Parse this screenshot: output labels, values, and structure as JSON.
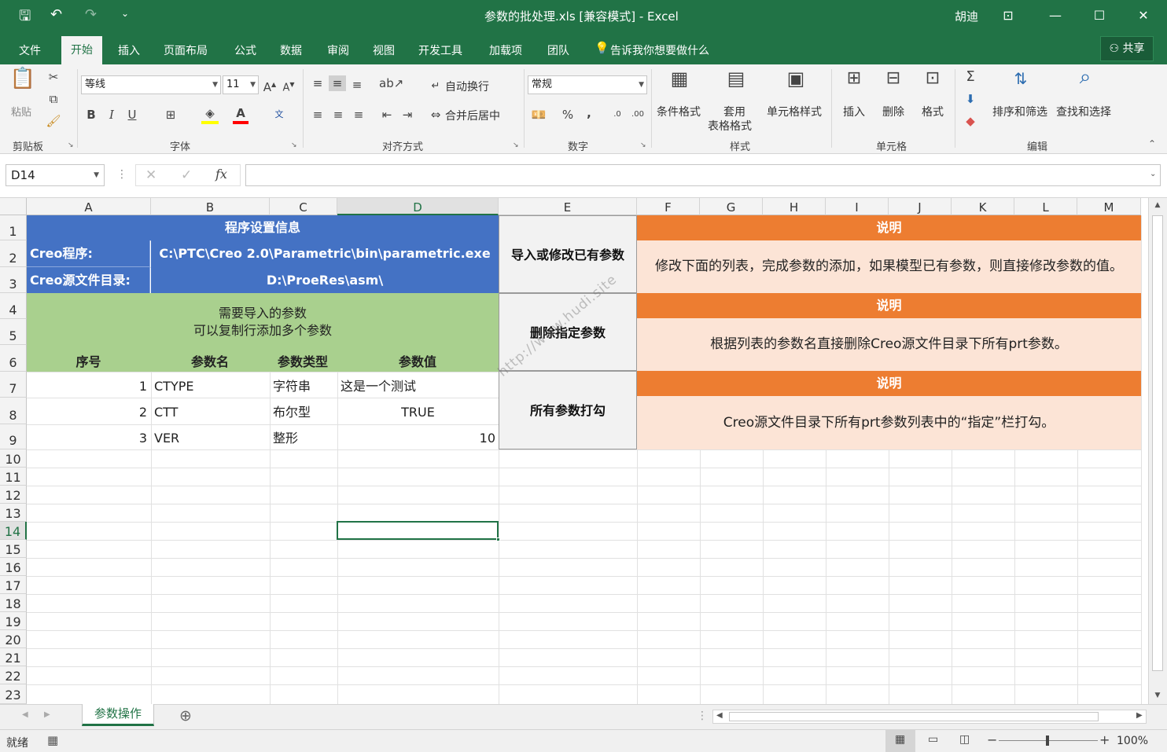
{
  "window": {
    "title": "参数的批处理.xls  [兼容模式]  -  Excel",
    "user": "胡迪",
    "controls": {
      "ribbon_display": "⊡",
      "minimize": "—",
      "maximize": "☐",
      "close": "✕"
    }
  },
  "quick_access": {
    "save": "🖫",
    "undo": "↶",
    "redo": "↷",
    "customize": "⌄"
  },
  "tabs": [
    "文件",
    "开始",
    "插入",
    "页面布局",
    "公式",
    "数据",
    "审阅",
    "视图",
    "开发工具",
    "加载项",
    "团队"
  ],
  "active_tab": "开始",
  "tell_me": "告诉我你想要做什么",
  "share": "共享",
  "ribbon": {
    "clipboard": {
      "paste": "粘贴",
      "label": "剪贴板"
    },
    "font": {
      "name": "等线",
      "size": "11",
      "bold": "B",
      "italic": "I",
      "underline": "U",
      "label": "字体"
    },
    "alignment": {
      "wrap": "自动换行",
      "merge": "合并后居中",
      "label": "对齐方式"
    },
    "number": {
      "format": "常规",
      "percent": "%",
      "comma": ",",
      "label": "数字"
    },
    "styles": {
      "conditional": "条件格式",
      "table_1": "套用",
      "table_2": "表格格式",
      "cell_styles": "单元格样式",
      "label": "样式"
    },
    "cells": {
      "insert": "插入",
      "delete": "删除",
      "format": "格式",
      "label": "单元格"
    },
    "editing": {
      "sort": "排序和筛选",
      "find": "查找和选择",
      "label": "编辑"
    }
  },
  "formula_bar": {
    "name_box": "D14",
    "cancel": "✕",
    "enter": "✓",
    "fx": "fx",
    "value": ""
  },
  "columns": [
    "A",
    "B",
    "C",
    "D",
    "E",
    "F",
    "G",
    "H",
    "I",
    "J",
    "K",
    "L",
    "M"
  ],
  "selected_column": "D",
  "rows": [
    "1",
    "2",
    "3",
    "4",
    "5",
    "6",
    "7",
    "8",
    "9",
    "10",
    "11",
    "12",
    "13",
    "14",
    "15",
    "16",
    "17",
    "18",
    "19",
    "20",
    "21",
    "22",
    "23"
  ],
  "selected_row": "14",
  "sheet": {
    "settings_title": "程序设置信息",
    "creo_label": "Creo程序:",
    "creo_path": "C:\\PTC\\Creo 2.0\\Parametric\\bin\\parametric.exe",
    "src_label": "Creo源文件目录:",
    "src_path": "D:\\ProeRes\\asm\\",
    "params_title_1": "需要导入的参数",
    "params_title_2": "可以复制行添加多个参数",
    "headers": [
      "序号",
      "参数名",
      "参数类型",
      "参数值"
    ],
    "params": [
      {
        "no": "1",
        "name": "CTYPE",
        "type": "字符串",
        "value": "这是一个测试"
      },
      {
        "no": "2",
        "name": "CTT",
        "type": "布尔型",
        "value": "TRUE"
      },
      {
        "no": "3",
        "name": "VER",
        "type": "整形",
        "value": "10"
      }
    ],
    "actions": [
      {
        "button": "导入或修改已有参数",
        "header": "说明",
        "desc": "修改下面的列表，完成参数的添加，如果模型已有参数，则直接修改参数的值。"
      },
      {
        "button": "删除指定参数",
        "header": "说明",
        "desc": "根据列表的参数名直接删除Creo源文件目录下所有prt参数。"
      },
      {
        "button": "所有参数打勾",
        "header": "说明",
        "desc": "Creo源文件目录下所有prt参数列表中的“指定”栏打勾。"
      }
    ],
    "watermark": "http://www.hudi.site"
  },
  "sheet_tabs": [
    "参数操作"
  ],
  "add_sheet": "⊕",
  "status": {
    "ready": "就绪",
    "zoom": "100%",
    "minus": "−",
    "plus": "+"
  },
  "colors": {
    "excel_green": "#217346",
    "header_blue": "#4472c4",
    "param_green": "#a9d08e",
    "orange": "#ed7d31",
    "peach": "#fce4d6"
  }
}
